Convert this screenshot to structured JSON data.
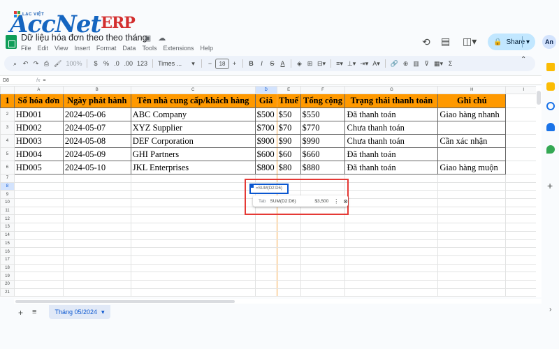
{
  "logo": {
    "small": "LẠC VIỆT",
    "acc": "Acc",
    "net": "Net",
    "erp": "ERP"
  },
  "doc": {
    "title": "Dữ liệu hóa đơn theo theo tháng"
  },
  "menu": [
    "File",
    "Edit",
    "View",
    "Insert",
    "Format",
    "Data",
    "Tools",
    "Extensions",
    "Help"
  ],
  "share_label": "Share",
  "avatar": "An",
  "toolbar": {
    "zoom": "100%",
    "currency": "$",
    "percent": "%",
    "dec_less": ".0",
    "dec_more": ".00",
    "num_fmt": "123",
    "font": "Times ...",
    "font_size": "18",
    "minus": "−",
    "plus": "+",
    "bold": "B",
    "italic": "I",
    "strike": "S",
    "textcolor": "A",
    "sigma": "Σ"
  },
  "formula_bar": {
    "name_box": "D8",
    "fx": "fx",
    "content": "="
  },
  "columns": [
    "A",
    "B",
    "C",
    "D",
    "E",
    "F",
    "G",
    "H",
    "I"
  ],
  "header_row": [
    "Số hóa đơn",
    "Ngày phát hành",
    "Tên nhà cung cấp/khách hàng",
    "Giá",
    "Thuế",
    "Tổng cộng",
    "Trạng thái thanh toán",
    "Ghi chú"
  ],
  "rows": [
    [
      "HD001",
      "2024-05-06",
      "ABC Company",
      "$500",
      "$50",
      "$550",
      "Đã thanh toán",
      "Giao hàng nhanh"
    ],
    [
      "HD002",
      "2024-05-07",
      "XYZ Supplier",
      "$700",
      "$70",
      "$770",
      "Chưa thanh toán",
      ""
    ],
    [
      "HD003",
      "2024-05-08",
      "DEF Corporation",
      "$900",
      "$90",
      "$990",
      "Chưa thanh toán",
      "Cần xác nhận"
    ],
    [
      "HD004",
      "2024-05-09",
      "GHI Partners",
      "$600",
      "$60",
      "$660",
      "Đã thanh toán",
      ""
    ],
    [
      "HD005",
      "2024-05-10",
      "JKL Enterprises",
      "$800",
      "$80",
      "$880",
      "Đã thanh toán",
      "Giao hàng muộn"
    ]
  ],
  "row_numbers": [
    "1",
    "2",
    "3",
    "4",
    "5",
    "6",
    "7",
    "8",
    "9",
    "10",
    "11",
    "12",
    "13",
    "14",
    "15",
    "16",
    "17",
    "18",
    "19",
    "20",
    "21"
  ],
  "active_cell": {
    "text": "=SUM(D2:D6)"
  },
  "suggestion": {
    "tab": "Tab",
    "formula": "SUM(D2:D6)",
    "result": "$3,500"
  },
  "sheet_tab": "Tháng 05/2024",
  "colors": {
    "header_fill": "#ff9900",
    "accent": "#0b57d0",
    "highlight_box": "#e53935"
  }
}
